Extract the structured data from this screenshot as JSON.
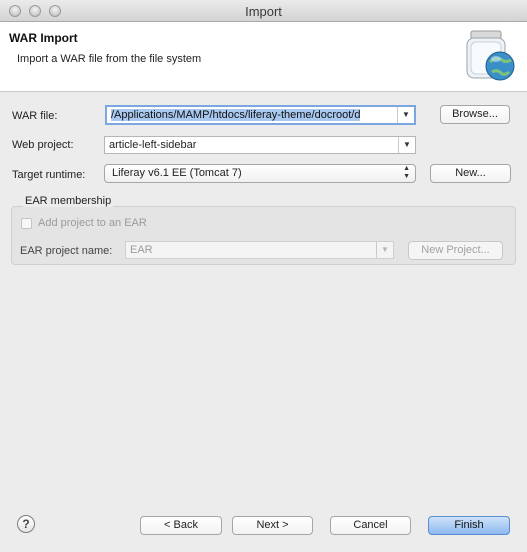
{
  "window": {
    "title": "Import"
  },
  "banner": {
    "title": "WAR Import",
    "description": "Import a WAR file from the file system"
  },
  "form": {
    "war_file": {
      "label": "WAR file:",
      "value": "/Applications/MAMP/htdocs/liferay-theme/docroot/d",
      "browse_label": "Browse..."
    },
    "web_project": {
      "label": "Web project:",
      "value": "article-left-sidebar"
    },
    "target_runtime": {
      "label": "Target runtime:",
      "value": "Liferay v6.1 EE (Tomcat 7)",
      "new_label": "New..."
    },
    "ear": {
      "group_title": "EAR membership",
      "checkbox_label": "Add project to an EAR",
      "checked": false,
      "project_name_label": "EAR project name:",
      "project_name_value": "EAR",
      "new_project_label": "New Project..."
    }
  },
  "footer": {
    "help_glyph": "?",
    "back_label": "< Back",
    "next_label": "Next >",
    "cancel_label": "Cancel",
    "finish_label": "Finish"
  },
  "colors": {
    "accent": "#8db9ef",
    "selection": "#a8c8f0",
    "background": "#ececec"
  },
  "icons": {
    "banner": "war-jar-globe-icon",
    "help": "help-icon",
    "dropdown": "chevron-down-icon"
  }
}
